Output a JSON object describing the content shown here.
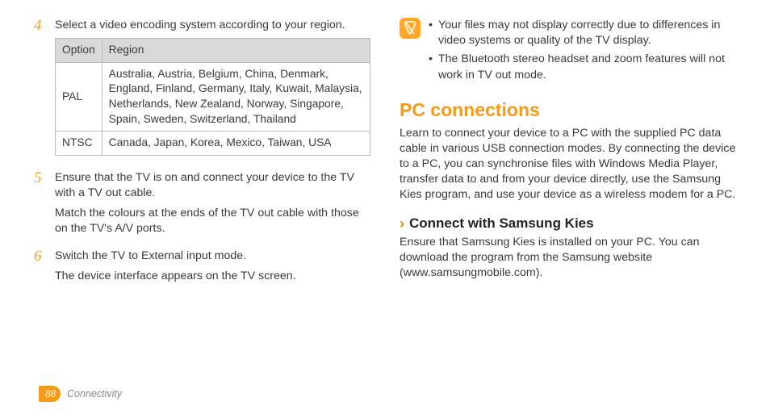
{
  "left": {
    "step4": {
      "num": "4",
      "text": "Select a video encoding system according to your region.",
      "table": {
        "head_option": "Option",
        "head_region": "Region",
        "rows": [
          {
            "option": "PAL",
            "region": "Australia, Austria, Belgium, China, Denmark, England, Finland, Germany, Italy, Kuwait, Malaysia, Netherlands, New Zealand, Norway, Singapore, Spain, Sweden, Switzerland, Thailand"
          },
          {
            "option": "NTSC",
            "region": "Canada, Japan, Korea, Mexico, Taiwan, USA"
          }
        ]
      }
    },
    "step5": {
      "num": "5",
      "p1": "Ensure that the TV is on and connect your device to the TV with a TV out cable.",
      "p2": "Match the colours at the ends of the TV out cable with those on the TV's A/V ports."
    },
    "step6": {
      "num": "6",
      "p1": "Switch the TV to External input mode.",
      "p2": "The device interface appears on the TV screen."
    }
  },
  "right": {
    "notes": [
      "Your files may not display correctly due to differences in video systems or quality of the TV display.",
      "The Bluetooth stereo headset and zoom features will not work in TV out mode."
    ],
    "section_title": "PC connections",
    "section_intro": "Learn to connect your device to a PC with the supplied PC data cable in various USB connection modes. By connecting the device to a PC, you can synchronise files with Windows Media Player, transfer data to and from your device directly, use the Samsung Kies program, and use your device as a wireless modem for a PC.",
    "sub_title": "Connect with Samsung Kies",
    "sub_text": "Ensure that Samsung Kies is installed on your PC. You can download the program from the Samsung website (www.samsungmobile.com)."
  },
  "footer": {
    "page": "88",
    "chapter": "Connectivity"
  }
}
